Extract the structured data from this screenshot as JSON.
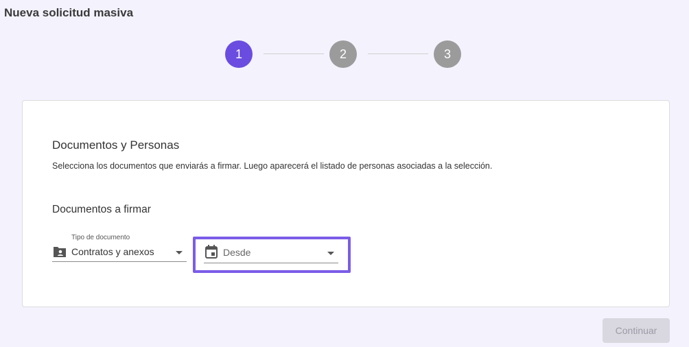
{
  "page": {
    "title": "Nueva solicitud masiva"
  },
  "stepper": {
    "steps": [
      {
        "label": "1",
        "state": "active"
      },
      {
        "label": "2",
        "state": "inactive"
      },
      {
        "label": "3",
        "state": "inactive"
      }
    ],
    "active_color": "#6a4ce0",
    "inactive_color": "#9b9b9b"
  },
  "card": {
    "title": "Documentos y Personas",
    "description": "Selecciona los documentos que enviarás a firmar. Luego aparecerá el listado de personas asociadas a la selección.",
    "subtitle": "Documentos a firmar",
    "fields": {
      "doc_type": {
        "label": "Tipo de documento",
        "value": "Contratos y anexos",
        "icon": "folder-account-icon"
      },
      "date_from": {
        "placeholder": "Desde",
        "icon": "calendar-icon",
        "highlighted": true
      }
    }
  },
  "actions": {
    "continue_label": "Continuar",
    "continue_enabled": false
  },
  "colors": {
    "background": "#f4f2fd",
    "highlight": "#7b5ce8"
  }
}
